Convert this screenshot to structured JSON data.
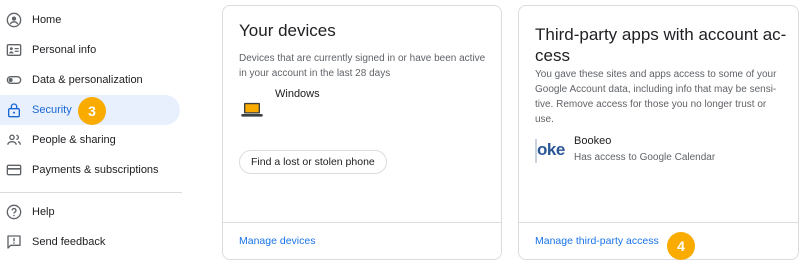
{
  "sidebar": {
    "items": [
      {
        "label": "Home",
        "icon": "account-circle-icon"
      },
      {
        "label": "Personal info",
        "icon": "id-card-icon"
      },
      {
        "label": "Data & personalization",
        "icon": "toggle-icon"
      },
      {
        "label": "Security",
        "icon": "lock-icon",
        "active": true
      },
      {
        "label": "People & sharing",
        "icon": "people-icon"
      },
      {
        "label": "Payments & subscriptions",
        "icon": "credit-card-icon"
      },
      {
        "label": "Help",
        "icon": "help-icon"
      },
      {
        "label": "Send feedback",
        "icon": "feedback-icon"
      }
    ]
  },
  "badges": {
    "security": "3",
    "third_party": "4"
  },
  "devices_card": {
    "title": "Your devices",
    "description": "Devices that are currently signed in or have been active in your account in the last 28 days",
    "device_name": "Windows",
    "find_phone_label": "Find a lost or stolen phone",
    "manage_label": "Manage devices"
  },
  "third_party_card": {
    "title_line1": "Third-party apps with account ac-",
    "title_line2": "cess",
    "description": "You gave these sites and apps access to some of your Google Account data, including info that may be sensi- tive. Remove access for those you no longer trust or use.",
    "app_logo_text": "oke",
    "app_name": "Bookeo",
    "app_access": "Has access to Google Calendar",
    "manage_label": "Manage third-party access"
  },
  "colors": {
    "accent": "#1a73e8",
    "active_bg": "#e8f0fe",
    "badge": "#f9ab00",
    "border": "#dadce0"
  }
}
